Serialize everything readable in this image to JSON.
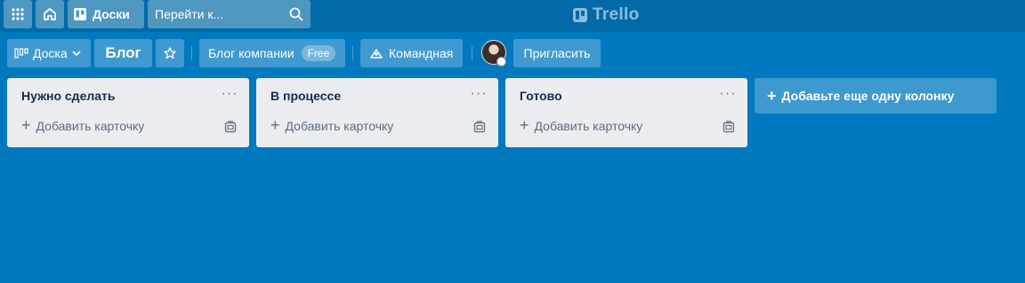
{
  "header": {
    "apps_icon": "apps-grid-icon",
    "home_icon": "home-icon",
    "boards_label": "Доски",
    "search_placeholder": "Перейти к...",
    "logo_text": "Trello"
  },
  "board": {
    "view_label": "Доска",
    "title": "Блог",
    "team_label": "Блог компании",
    "team_badge": "Free",
    "visibility_label": "Командная",
    "invite_label": "Пригласить"
  },
  "lists": [
    {
      "title": "Нужно сделать",
      "menu": "···",
      "add_card_label": "Добавить карточку"
    },
    {
      "title": "В процессе",
      "menu": "···",
      "add_card_label": "Добавить карточку"
    },
    {
      "title": "Готово",
      "menu": "···",
      "add_card_label": "Добавить карточку"
    }
  ],
  "add_list_label": "Добавьте еще одну колонку",
  "colors": {
    "board_background": "#0079bf",
    "header_background": "#026aa7",
    "list_background": "#ebecf0"
  }
}
